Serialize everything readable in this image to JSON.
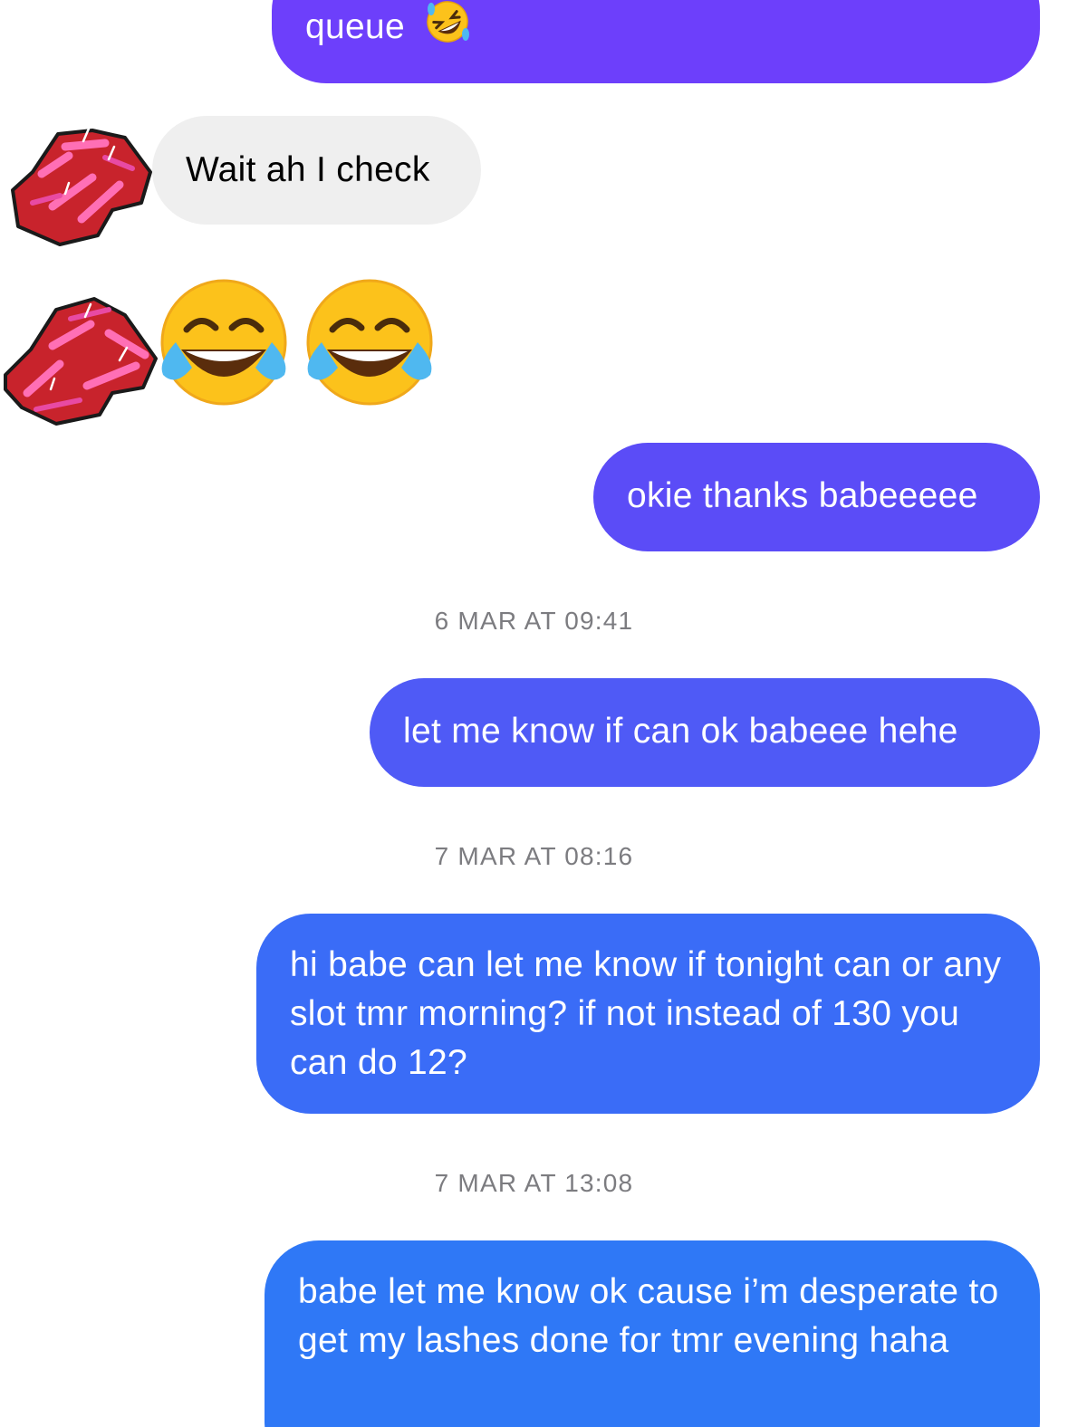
{
  "messages": {
    "m1": {
      "text": "queue",
      "emoji": "rolling-on-floor-laughing"
    },
    "m2": {
      "text": "Wait ah I check"
    },
    "m3": {
      "emojis": [
        "face-with-tears-of-joy",
        "face-with-tears-of-joy"
      ]
    },
    "m4": {
      "text": "okie thanks babeeeee"
    },
    "m5": {
      "text": "let me know if can ok babeee hehe"
    },
    "m6": {
      "text": "hi babe can let me know if tonight can or any slot tmr morning? if not instead of 130 you can do 12?"
    },
    "m7": {
      "text": "babe let me know ok cause i’m desperate to get my lashes done for tmr evening haha"
    }
  },
  "timestamps": {
    "t1": "6 MAR AT 09:41",
    "t2": "7 MAR AT 08:16",
    "t3": "7 MAR AT 13:08"
  },
  "colors": {
    "bubble_purple": "#6d3ffb",
    "bubble_indigo": "#5b4cf7",
    "bubble_blue_violet": "#4f5af6",
    "bubble_blue": "#3a6cf7",
    "bubble_blue_2": "#2f78f6",
    "incoming_bubble": "#efefef",
    "timestamp_text": "#7c7c80"
  }
}
